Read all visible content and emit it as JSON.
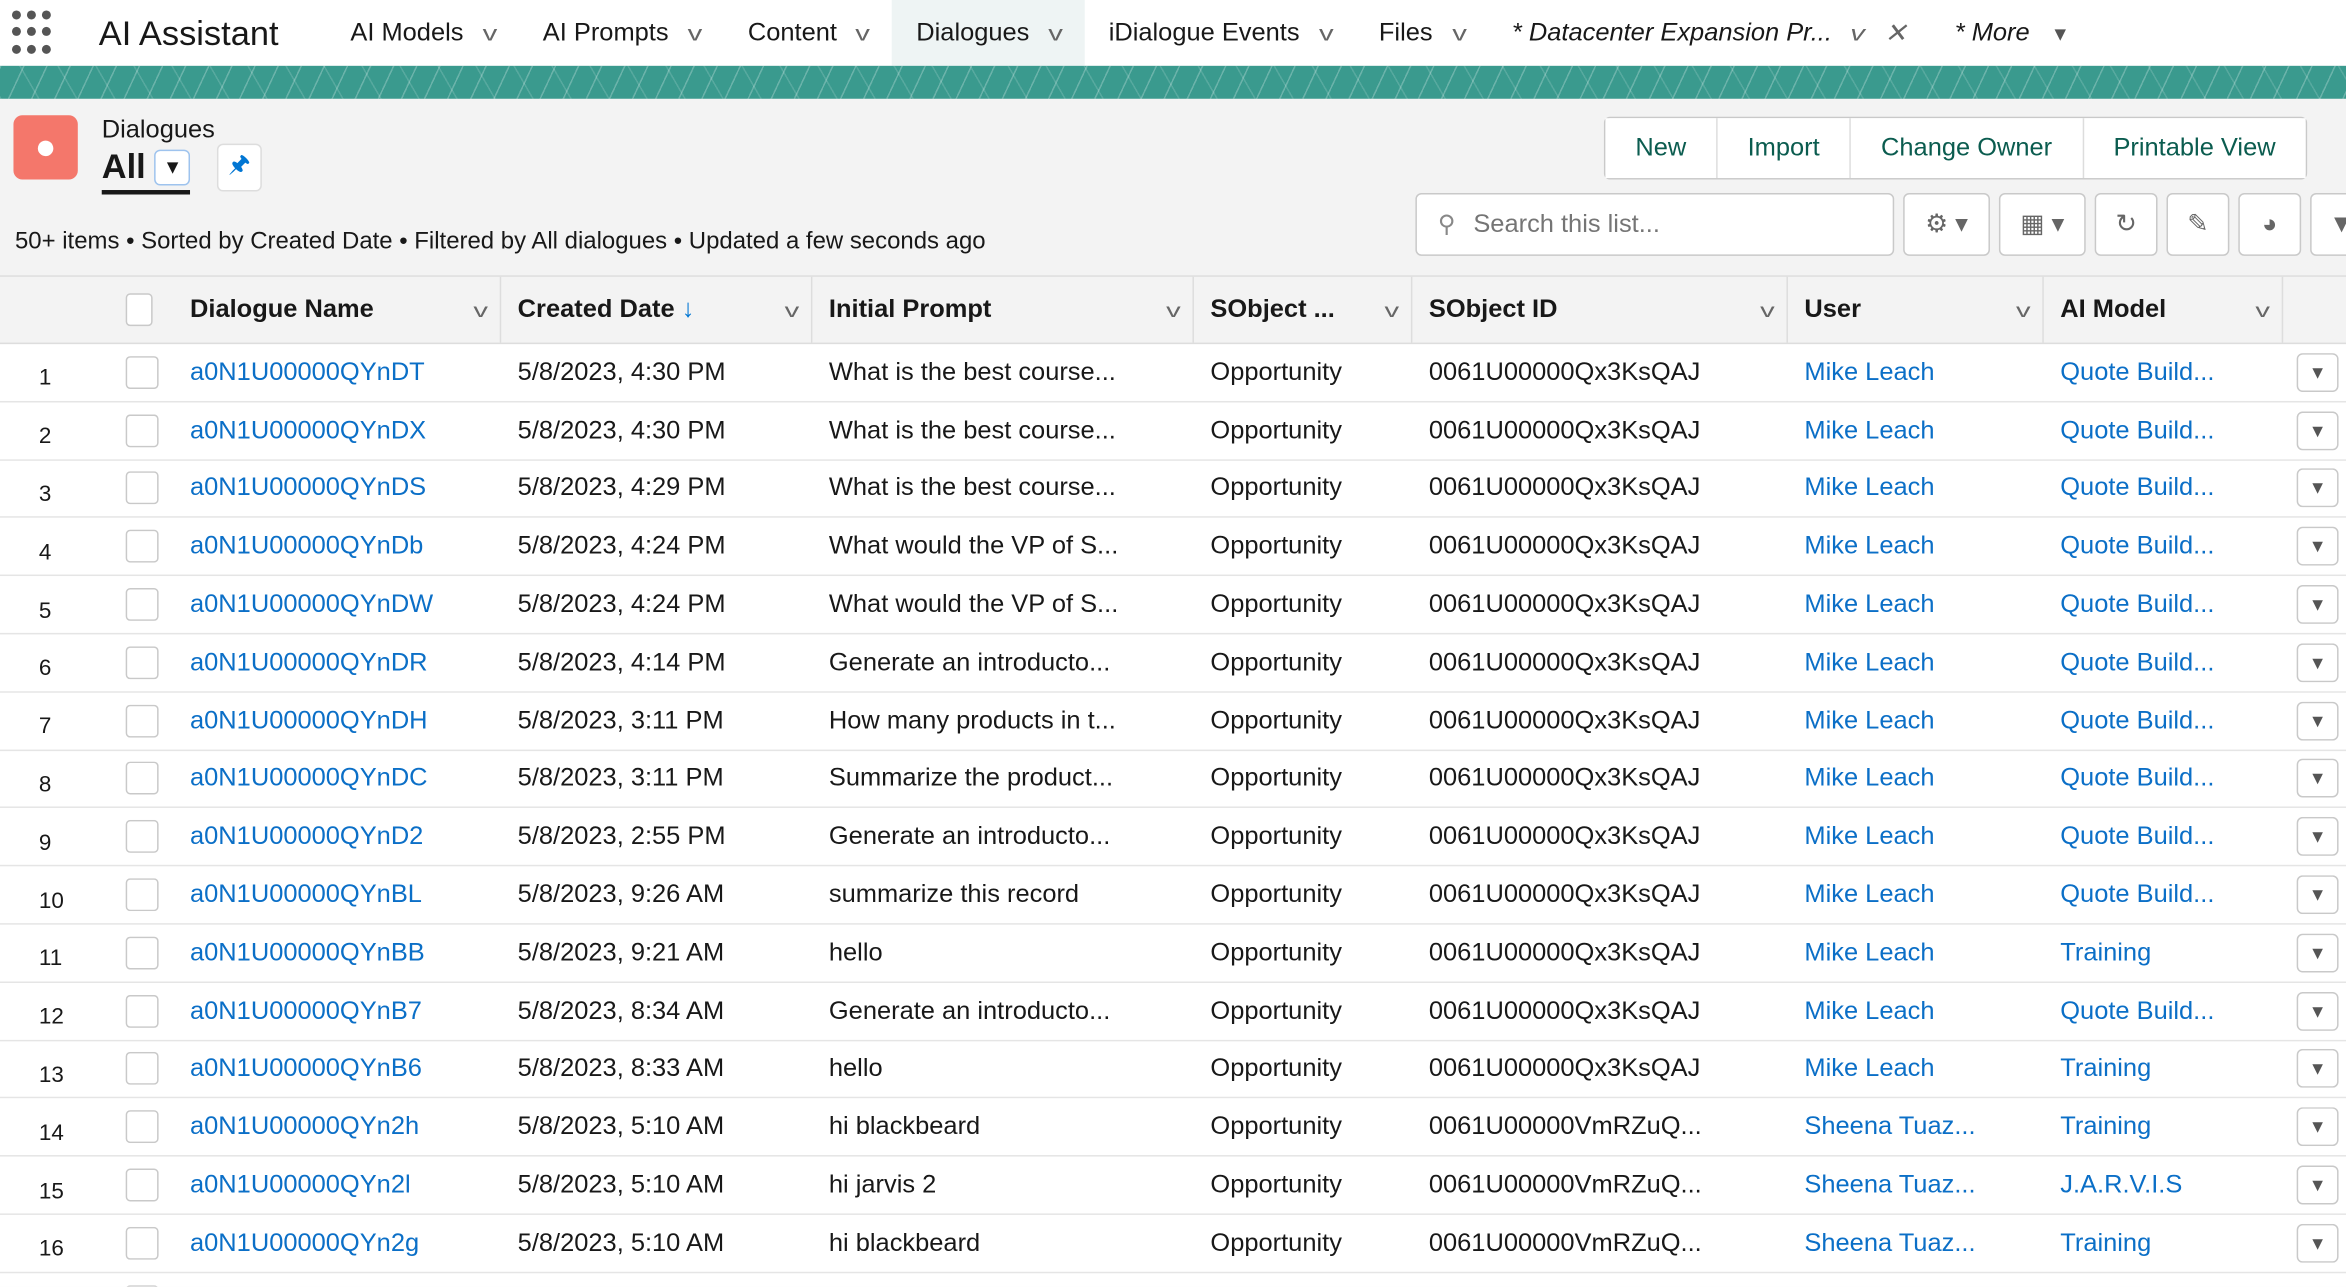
{
  "nav": {
    "app_name": "AI Assistant",
    "tabs": [
      {
        "label": "AI Models",
        "active": false
      },
      {
        "label": "AI Prompts",
        "active": false
      },
      {
        "label": "Content",
        "active": false
      },
      {
        "label": "Dialogues",
        "active": true
      },
      {
        "label": "iDialogue Events",
        "active": false
      },
      {
        "label": "Files",
        "active": false
      },
      {
        "label": "* Datacenter Expansion Pr...",
        "active": false
      },
      {
        "label": "* More",
        "active": false
      }
    ]
  },
  "colors": {
    "banner": "#3a9a8e",
    "object_icon": "#f4776b",
    "link": "#0b6fc7",
    "button_text": "#0b5c4f"
  },
  "header": {
    "object_label": "Dialogues",
    "view_name": "All",
    "actions": [
      "New",
      "Import",
      "Change Owner",
      "Printable View"
    ],
    "status": "50+ items • Sorted by Created Date • Filtered by All dialogues • Updated a few seconds ago",
    "search_placeholder": "Search this list..."
  },
  "table": {
    "columns": [
      "Dialogue Name",
      "Created Date",
      "Initial Prompt",
      "SObject ...",
      "SObject ID",
      "User",
      "AI Model"
    ],
    "sort_indicator": "↓",
    "rows": [
      {
        "n": "1",
        "name": "a0N1U00000QYnDT",
        "created": "5/8/2023, 4:30 PM",
        "prompt": "What is the best course...",
        "sobject": "Opportunity",
        "sid": "0061U00000Qx3KsQAJ",
        "user": "Mike Leach",
        "model": "Quote Build..."
      },
      {
        "n": "2",
        "name": "a0N1U00000QYnDX",
        "created": "5/8/2023, 4:30 PM",
        "prompt": "What is the best course...",
        "sobject": "Opportunity",
        "sid": "0061U00000Qx3KsQAJ",
        "user": "Mike Leach",
        "model": "Quote Build..."
      },
      {
        "n": "3",
        "name": "a0N1U00000QYnDS",
        "created": "5/8/2023, 4:29 PM",
        "prompt": "What is the best course...",
        "sobject": "Opportunity",
        "sid": "0061U00000Qx3KsQAJ",
        "user": "Mike Leach",
        "model": "Quote Build..."
      },
      {
        "n": "4",
        "name": "a0N1U00000QYnDb",
        "created": "5/8/2023, 4:24 PM",
        "prompt": "What would the VP of S...",
        "sobject": "Opportunity",
        "sid": "0061U00000Qx3KsQAJ",
        "user": "Mike Leach",
        "model": "Quote Build..."
      },
      {
        "n": "5",
        "name": "a0N1U00000QYnDW",
        "created": "5/8/2023, 4:24 PM",
        "prompt": "What would the VP of S...",
        "sobject": "Opportunity",
        "sid": "0061U00000Qx3KsQAJ",
        "user": "Mike Leach",
        "model": "Quote Build..."
      },
      {
        "n": "6",
        "name": "a0N1U00000QYnDR",
        "created": "5/8/2023, 4:14 PM",
        "prompt": "Generate an introducto...",
        "sobject": "Opportunity",
        "sid": "0061U00000Qx3KsQAJ",
        "user": "Mike Leach",
        "model": "Quote Build..."
      },
      {
        "n": "7",
        "name": "a0N1U00000QYnDH",
        "created": "5/8/2023, 3:11 PM",
        "prompt": "How many products in t...",
        "sobject": "Opportunity",
        "sid": "0061U00000Qx3KsQAJ",
        "user": "Mike Leach",
        "model": "Quote Build..."
      },
      {
        "n": "8",
        "name": "a0N1U00000QYnDC",
        "created": "5/8/2023, 3:11 PM",
        "prompt": "Summarize the product...",
        "sobject": "Opportunity",
        "sid": "0061U00000Qx3KsQAJ",
        "user": "Mike Leach",
        "model": "Quote Build..."
      },
      {
        "n": "9",
        "name": "a0N1U00000QYnD2",
        "created": "5/8/2023, 2:55 PM",
        "prompt": "Generate an introducto...",
        "sobject": "Opportunity",
        "sid": "0061U00000Qx3KsQAJ",
        "user": "Mike Leach",
        "model": "Quote Build..."
      },
      {
        "n": "10",
        "name": "a0N1U00000QYnBL",
        "created": "5/8/2023, 9:26 AM",
        "prompt": "summarize this record",
        "sobject": "Opportunity",
        "sid": "0061U00000Qx3KsQAJ",
        "user": "Mike Leach",
        "model": "Quote Build..."
      },
      {
        "n": "11",
        "name": "a0N1U00000QYnBB",
        "created": "5/8/2023, 9:21 AM",
        "prompt": "hello",
        "sobject": "Opportunity",
        "sid": "0061U00000Qx3KsQAJ",
        "user": "Mike Leach",
        "model": "Training"
      },
      {
        "n": "12",
        "name": "a0N1U00000QYnB7",
        "created": "5/8/2023, 8:34 AM",
        "prompt": "Generate an introducto...",
        "sobject": "Opportunity",
        "sid": "0061U00000Qx3KsQAJ",
        "user": "Mike Leach",
        "model": "Quote Build..."
      },
      {
        "n": "13",
        "name": "a0N1U00000QYnB6",
        "created": "5/8/2023, 8:33 AM",
        "prompt": "hello",
        "sobject": "Opportunity",
        "sid": "0061U00000Qx3KsQAJ",
        "user": "Mike Leach",
        "model": "Training"
      },
      {
        "n": "14",
        "name": "a0N1U00000QYn2h",
        "created": "5/8/2023, 5:10 AM",
        "prompt": "hi blackbeard",
        "sobject": "Opportunity",
        "sid": "0061U00000VmRZuQ...",
        "user": "Sheena Tuaz...",
        "model": "Training"
      },
      {
        "n": "15",
        "name": "a0N1U00000QYn2l",
        "created": "5/8/2023, 5:10 AM",
        "prompt": "hi jarvis 2",
        "sobject": "Opportunity",
        "sid": "0061U00000VmRZuQ...",
        "user": "Sheena Tuaz...",
        "model": "J.A.R.V.I.S"
      },
      {
        "n": "16",
        "name": "a0N1U00000QYn2g",
        "created": "5/8/2023, 5:10 AM",
        "prompt": "hi blackbeard",
        "sobject": "Opportunity",
        "sid": "0061U00000VmRZuQ...",
        "user": "Sheena Tuaz...",
        "model": "Training"
      }
    ]
  }
}
